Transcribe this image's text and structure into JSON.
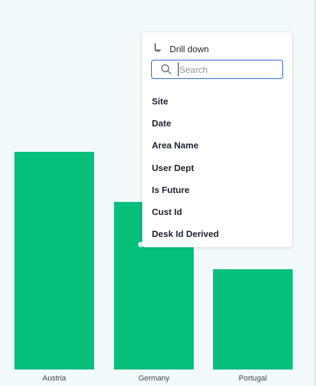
{
  "chart_data": {
    "type": "bar",
    "categories": [
      "Austria",
      "Germany",
      "Portugal"
    ],
    "values": [
      100,
      77,
      46
    ],
    "ylim": [
      0,
      100
    ],
    "bar_color": "#06bf7b",
    "xlabel": "",
    "ylabel": ""
  },
  "drill_menu": {
    "header_label": "Drill down",
    "header_icon": "arrow-down-icon",
    "search_placeholder": "Search",
    "search_value": "",
    "items": [
      {
        "label": "Site"
      },
      {
        "label": "Date"
      },
      {
        "label": "Area Name"
      },
      {
        "label": "User Dept"
      },
      {
        "label": "Is Future"
      },
      {
        "label": "Cust Id"
      },
      {
        "label": "Desk Id Derived"
      }
    ]
  },
  "colors": {
    "background": "#f1f9fa",
    "accent": "#2359d1",
    "text": "#1d232f"
  }
}
